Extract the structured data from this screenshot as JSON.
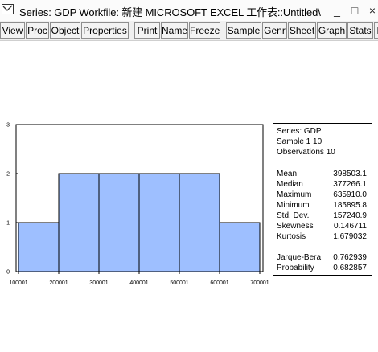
{
  "window": {
    "title": "Series: GDP   Workfile: 新建 MICROSOFT EXCEL 工作表::Untitled\\",
    "minimize": "_",
    "maximize": "□",
    "close": "×"
  },
  "toolbar": [
    {
      "label": "View"
    },
    {
      "label": "Proc"
    },
    {
      "label": "Object"
    },
    {
      "label": "Properties"
    },
    {
      "label": "Print"
    },
    {
      "label": "Name"
    },
    {
      "label": "Freeze"
    },
    {
      "label": "Sample"
    },
    {
      "label": "Genr"
    },
    {
      "label": "Sheet"
    },
    {
      "label": "Graph"
    },
    {
      "label": "Stats"
    },
    {
      "label": "I"
    }
  ],
  "chart_data": {
    "type": "bar",
    "title": "",
    "xlabel": "",
    "ylabel": "",
    "categories": [
      "100001-200000",
      "200001-300000",
      "300001-400000",
      "400001-500000",
      "500001-600000",
      "600001-700000"
    ],
    "values": [
      1,
      2,
      2,
      2,
      2,
      1
    ],
    "x_ticks": [
      "100001",
      "200001",
      "300001",
      "400001",
      "500001",
      "600001",
      "700001"
    ],
    "y_ticks": [
      "0",
      "1",
      "2",
      "3"
    ],
    "ylim": [
      0,
      3
    ],
    "bar_color": "#9ebfff",
    "grid": false
  },
  "stats": {
    "series_line": "Series: GDP",
    "sample_line": "Sample 1 10",
    "obs_line": "Observations 10",
    "rows": [
      {
        "label": "Mean",
        "value": "398503.1"
      },
      {
        "label": "Median",
        "value": "377266.1"
      },
      {
        "label": "Maximum",
        "value": "635910.0"
      },
      {
        "label": "Minimum",
        "value": "185895.8"
      },
      {
        "label": "Std. Dev.",
        "value": "157240.9"
      },
      {
        "label": "Skewness",
        "value": "0.146711"
      },
      {
        "label": "Kurtosis",
        "value": "1.679032"
      }
    ],
    "tests": [
      {
        "label": "Jarque-Bera",
        "value": "0.762939"
      },
      {
        "label": "Probability",
        "value": "0.682857"
      }
    ]
  }
}
